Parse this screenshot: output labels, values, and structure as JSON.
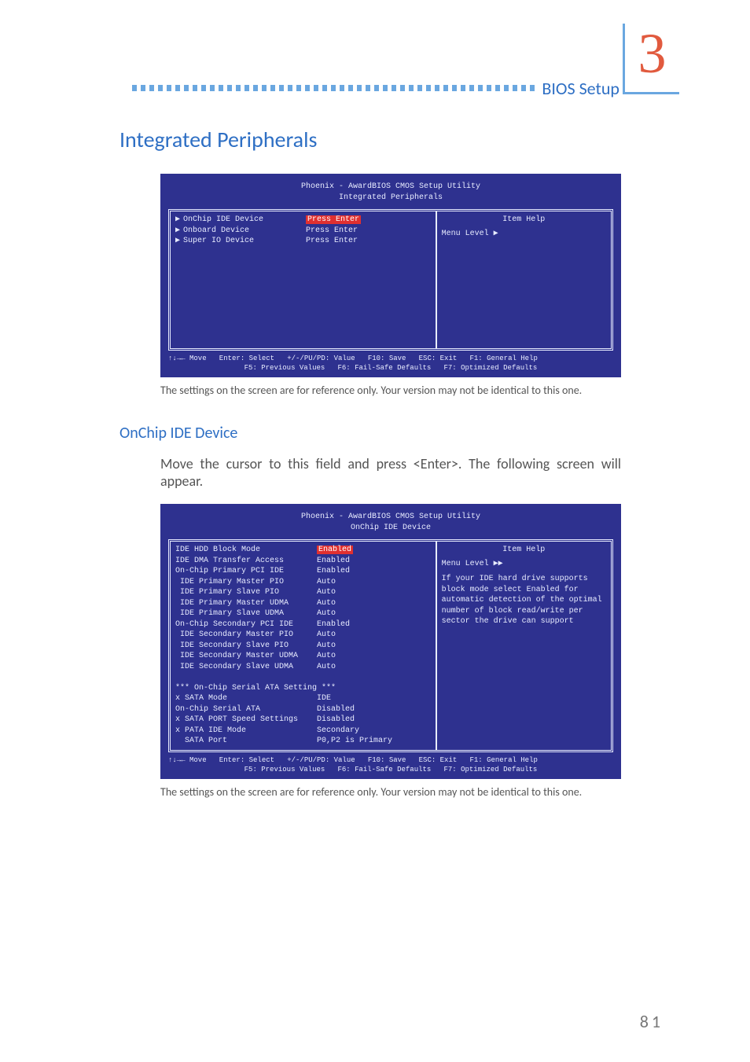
{
  "chapter_number": "3",
  "header_title": "BIOS Setup",
  "section_title": "Integrated Peripherals",
  "subsection_title": "OnChip IDE Device",
  "caption_text": "The settings on the screen are for reference only. Your version may not be identical to this one.",
  "body_text": "Move the cursor to this field and press <Enter>. The following screen will appear.",
  "page_number": "81",
  "bios1": {
    "title_l1": "Phoenix - AwardBIOS CMOS Setup Utility",
    "title_l2": "Integrated Peripherals",
    "help_title": "Item Help",
    "help_level": "Menu Level   ▶",
    "rows": [
      {
        "tri": "▶",
        "label": "OnChip IDE Device",
        "val": "Press Enter",
        "hl": true
      },
      {
        "tri": "▶",
        "label": "Onboard Device",
        "val": "Press Enter",
        "hl": false
      },
      {
        "tri": "▶",
        "label": "Super IO Device",
        "val": "Press Enter",
        "hl": false
      }
    ],
    "footer_l1": "↑↓→← Move   Enter: Select   +/-/PU/PD: Value   F10: Save   ESC: Exit   F1: General Help",
    "footer_l2": "F5: Previous Values   F6: Fail-Safe Defaults   F7: Optimized Defaults"
  },
  "bios2": {
    "title_l1": "Phoenix - AwardBIOS CMOS Setup Utility",
    "title_l2": "OnChip IDE Device",
    "help_title": "Item Help",
    "help_level": "Menu Level   ▶▶",
    "help_body": "If your IDE hard drive supports block mode select Enabled for automatic detection of the optimal number of block read/write per sector the drive can support",
    "rows": [
      {
        "label": "IDE HDD Block Mode",
        "val": "Enabled",
        "hl": true
      },
      {
        "label": "IDE DMA Transfer Access",
        "val": "Enabled"
      },
      {
        "label": "On-Chip Primary PCI IDE",
        "val": "Enabled"
      },
      {
        "label": " IDE Primary Master PIO",
        "val": "Auto"
      },
      {
        "label": " IDE Primary Slave PIO",
        "val": "Auto"
      },
      {
        "label": " IDE Primary Master UDMA",
        "val": "Auto"
      },
      {
        "label": " IDE Primary Slave UDMA",
        "val": "Auto"
      },
      {
        "label": "On-Chip Secondary PCI IDE",
        "val": "Enabled"
      },
      {
        "label": " IDE Secondary Master PIO",
        "val": "Auto"
      },
      {
        "label": " IDE Secondary Slave PIO",
        "val": "Auto"
      },
      {
        "label": " IDE Secondary Master UDMA",
        "val": "Auto"
      },
      {
        "label": " IDE Secondary Slave UDMA",
        "val": "Auto"
      },
      {
        "label": "",
        "val": ""
      },
      {
        "label": "*** On-Chip Serial ATA Setting ***",
        "val": ""
      },
      {
        "label": "x SATA Mode",
        "val": "IDE"
      },
      {
        "label": "On-Chip Serial ATA",
        "val": "Disabled"
      },
      {
        "label": "x SATA PORT Speed Settings",
        "val": "Disabled"
      },
      {
        "label": "x PATA IDE Mode",
        "val": "Secondary"
      },
      {
        "label": "  SATA Port",
        "val": "P0,P2 is Primary"
      }
    ],
    "footer_l1": "↑↓→← Move   Enter: Select   +/-/PU/PD: Value   F10: Save   ESC: Exit   F1: General Help",
    "footer_l2": "F5: Previous Values   F6: Fail-Safe Defaults   F7: Optimized Defaults"
  }
}
